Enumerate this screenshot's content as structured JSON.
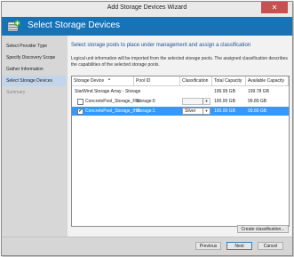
{
  "window": {
    "title": "Add Storage Devices Wizard",
    "close_symbol": "✕"
  },
  "header": {
    "title": "Select Storage Devices",
    "icon": "storage-add-icon"
  },
  "sidebar": {
    "items": [
      {
        "label": "Select Provider Type",
        "state": "done"
      },
      {
        "label": "Specify Discovery Scope",
        "state": "done"
      },
      {
        "label": "Gather Information",
        "state": "done"
      },
      {
        "label": "Select Storage Devices",
        "state": "active"
      },
      {
        "label": "Summary",
        "state": "disabled"
      }
    ]
  },
  "main": {
    "heading": "Select storage pools to place under management and assign a classification",
    "description": "Logical unit information will be imported from the selected storage pools. The assigned classification describes the capabilities of the selected storage pools.",
    "table": {
      "columns": [
        "Storage Device",
        "Pool ID",
        "Classification",
        "Total Capacity",
        "Available Capacity"
      ],
      "group_row": {
        "device": "StarWind Storage Array - Storage",
        "total": "199.99 GB",
        "available": "199.78 GB"
      },
      "rows": [
        {
          "checked": false,
          "device": "ConcretePool_Storage_Flat",
          "pool_id": "Storage:0",
          "classification": "",
          "total": "100.00 GB",
          "available": "99.89 GB",
          "selected": false
        },
        {
          "checked": true,
          "check_mark": "✔",
          "device": "ConcretePool_Storage_IHA",
          "pool_id": "Storage:1",
          "classification": "Silver",
          "total": "100.00 GB",
          "available": "99.89 GB",
          "selected": true
        }
      ]
    },
    "create_button": "Create classification..."
  },
  "footer": {
    "previous": "Previous",
    "next": "Next",
    "cancel": "Cancel"
  },
  "colors": {
    "header_bg": "#1873b6",
    "selection": "#3399ff",
    "sidebar_active": "#c2d5ea",
    "heading_text": "#1f4f8f"
  }
}
